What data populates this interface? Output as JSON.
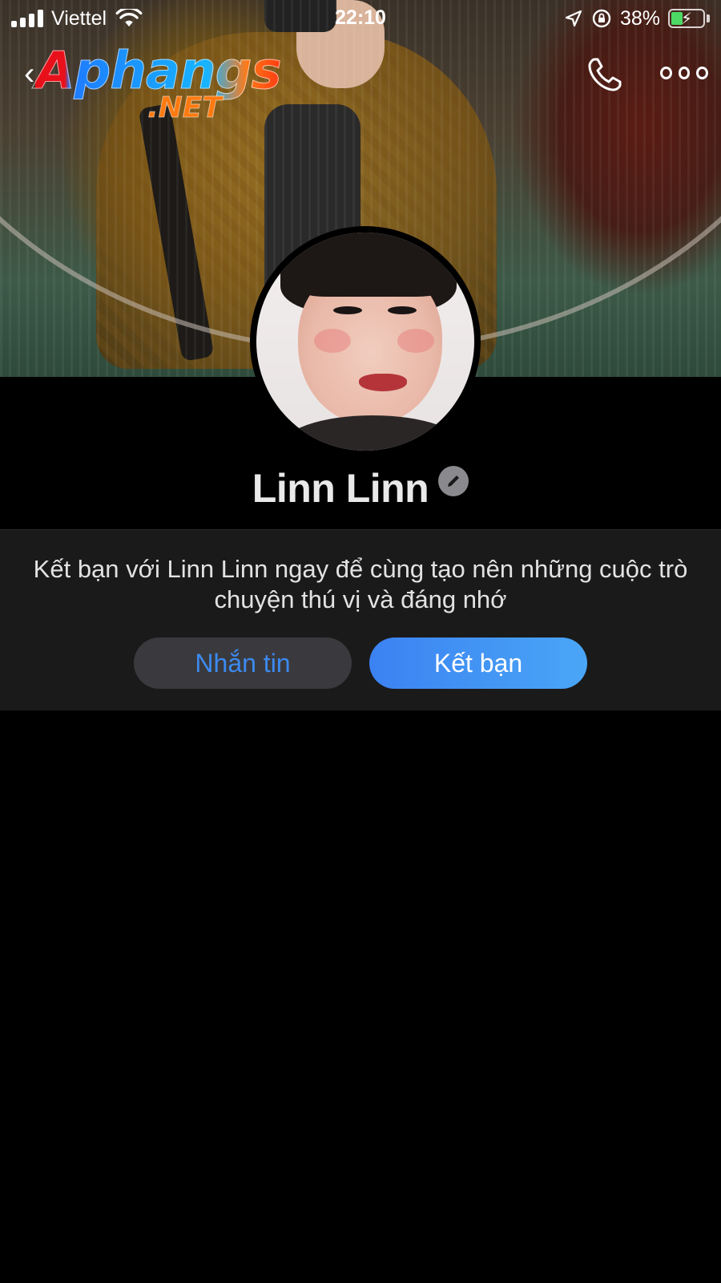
{
  "status_bar": {
    "carrier": "Viettel",
    "time": "22:10",
    "battery": "38%",
    "battery_level": 0.38
  },
  "watermark": {
    "main": "Aphangs",
    "sub": ".NET"
  },
  "profile": {
    "name": "Linn Linn"
  },
  "friend_prompt": {
    "text": "Kết bạn với Linn Linn ngay để cùng tạo nên những cuộc trò chuyện thú vị và đáng nhớ",
    "message_button": "Nhắn tin",
    "add_friend_button": "Kết bạn"
  },
  "colors": {
    "accent": "#3c8af0",
    "background": "#000000",
    "panel": "#1a1a1a",
    "battery_fill": "#4cd964"
  }
}
